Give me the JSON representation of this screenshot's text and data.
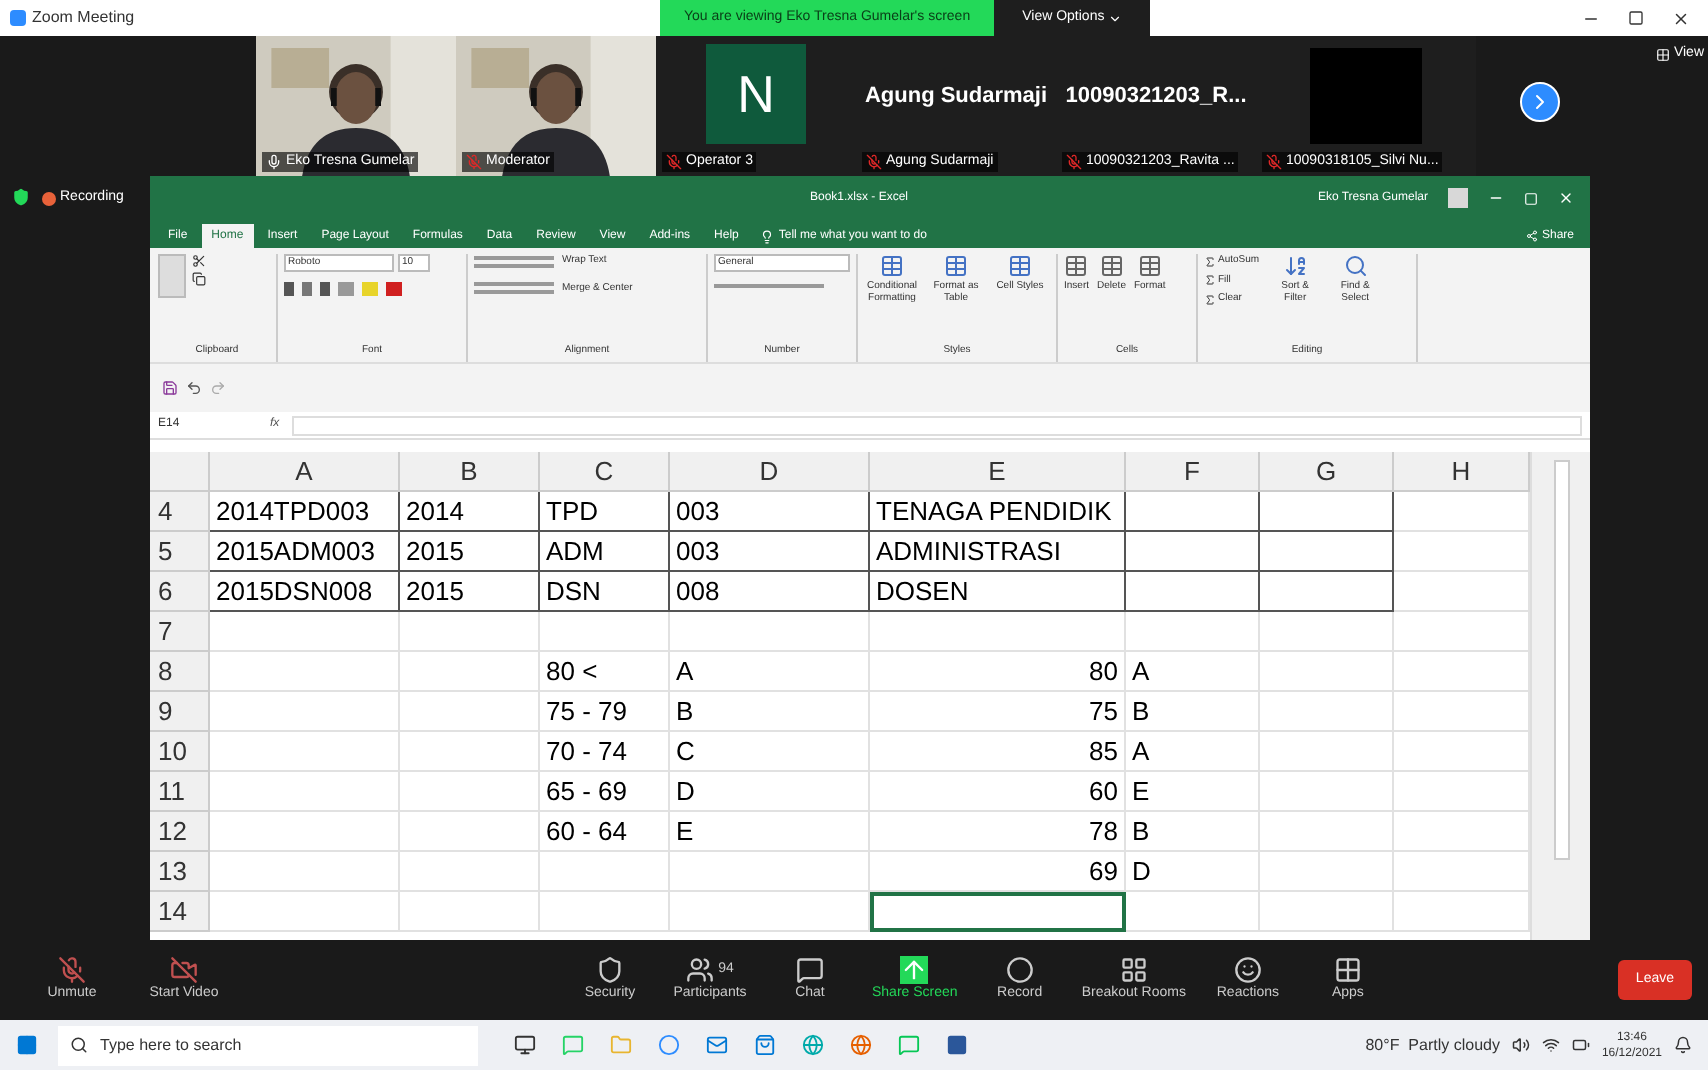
{
  "zoom_title": "Zoom Meeting",
  "banner": {
    "text": "You are viewing Eko Tresna Gumelar's screen",
    "button": "View Options"
  },
  "view_label": "View",
  "participants": [
    {
      "kind": "video",
      "name": "Eko Tresna Gumelar",
      "muted": false
    },
    {
      "kind": "video",
      "name": "Moderator",
      "muted": true
    },
    {
      "kind": "initial",
      "big_text": "N",
      "name": "Operator 3",
      "muted": true
    },
    {
      "kind": "name",
      "big_text": "Agung Sudarmaji",
      "name": "Agung Sudarmaji",
      "muted": true
    },
    {
      "kind": "name",
      "big_text": "10090321203_R...",
      "name": "10090321203_Ravita ...",
      "muted": true
    },
    {
      "kind": "blank",
      "name": "10090318105_Silvi Nu...",
      "muted": true
    }
  ],
  "recording": "Recording",
  "excel": {
    "title": "Book1.xlsx - Excel",
    "user": "Eko Tresna Gumelar",
    "tabs": [
      {
        "label": "File",
        "selected": false
      },
      {
        "label": "Home",
        "selected": true
      },
      {
        "label": "Insert",
        "selected": false
      },
      {
        "label": "Page Layout",
        "selected": false
      },
      {
        "label": "Formulas",
        "selected": false
      },
      {
        "label": "Data",
        "selected": false
      },
      {
        "label": "Review",
        "selected": false
      },
      {
        "label": "View",
        "selected": false
      },
      {
        "label": "Add-ins",
        "selected": false
      },
      {
        "label": "Help",
        "selected": false
      }
    ],
    "tell_me": "Tell me what you want to do",
    "share": "Share",
    "font_name": "Roboto",
    "font_size": "10",
    "wrap_text": "Wrap Text",
    "merge": "Merge & Center",
    "number_format": "General",
    "styles_buttons": [
      "Conditional Formatting",
      "Format as Table",
      "Cell Styles"
    ],
    "cells_buttons": [
      "Insert",
      "Delete",
      "Format"
    ],
    "editing_items": [
      "AutoSum",
      "Fill",
      "Clear"
    ],
    "editing_buttons": [
      "Sort & Filter",
      "Find & Select"
    ],
    "groups": [
      "Clipboard",
      "Font",
      "Alignment",
      "Number",
      "Styles",
      "Cells",
      "Editing"
    ],
    "name_box": "E14",
    "fx": "fx",
    "columns": [
      "A",
      "B",
      "C",
      "D",
      "E",
      "F",
      "G",
      "H"
    ],
    "rows": [
      {
        "num": "4",
        "kind": "table",
        "cells": [
          "2014TPD003",
          "2014",
          "TPD",
          "003",
          "TENAGA PENDIDIK",
          null,
          null,
          null
        ]
      },
      {
        "num": "5",
        "kind": "table",
        "cells": [
          "2015ADM003",
          "2015",
          "ADM",
          "003",
          "ADMINISTRASI",
          null,
          null,
          null
        ]
      },
      {
        "num": "6",
        "kind": "table",
        "cells": [
          "2015DSN008",
          "2015",
          "DSN",
          "008",
          "DOSEN",
          null,
          null,
          null
        ]
      },
      {
        "num": "7",
        "kind": "plain",
        "cells": [
          null,
          null,
          null,
          null,
          null,
          null,
          null,
          null
        ]
      },
      {
        "num": "8",
        "kind": "plain",
        "cells": [
          null,
          null,
          "80 <",
          "A",
          "80",
          "A",
          null,
          null
        ]
      },
      {
        "num": "9",
        "kind": "plain",
        "cells": [
          null,
          null,
          "75 - 79",
          "B",
          "75",
          "B",
          null,
          null
        ]
      },
      {
        "num": "10",
        "kind": "plain",
        "cells": [
          null,
          null,
          "70 - 74",
          "C",
          "85",
          "A",
          null,
          null
        ]
      },
      {
        "num": "11",
        "kind": "plain",
        "cells": [
          null,
          null,
          "65 - 69",
          "D",
          "60",
          "E",
          null,
          null
        ]
      },
      {
        "num": "12",
        "kind": "plain",
        "cells": [
          null,
          null,
          "60 - 64",
          "E",
          "78",
          "B",
          null,
          null
        ]
      },
      {
        "num": "13",
        "kind": "plain",
        "cells": [
          null,
          null,
          null,
          null,
          "69",
          "D",
          null,
          null
        ]
      },
      {
        "num": "14",
        "kind": "plain",
        "cells": [
          null,
          null,
          null,
          null,
          {
            "selected": true
          },
          null,
          null,
          null
        ]
      }
    ]
  },
  "toolbar": [
    "Unmute",
    "Start Video",
    "Security",
    "Participants",
    "Chat",
    "Share Screen",
    "Record",
    "Breakout Rooms",
    "Reactions",
    "Apps"
  ],
  "participant_count": "94",
  "leave": "Leave",
  "taskbar": {
    "search": "Type here to search",
    "weather": "80°F  Partly cloudy",
    "time": "13:46",
    "date": "16/12/2021"
  }
}
